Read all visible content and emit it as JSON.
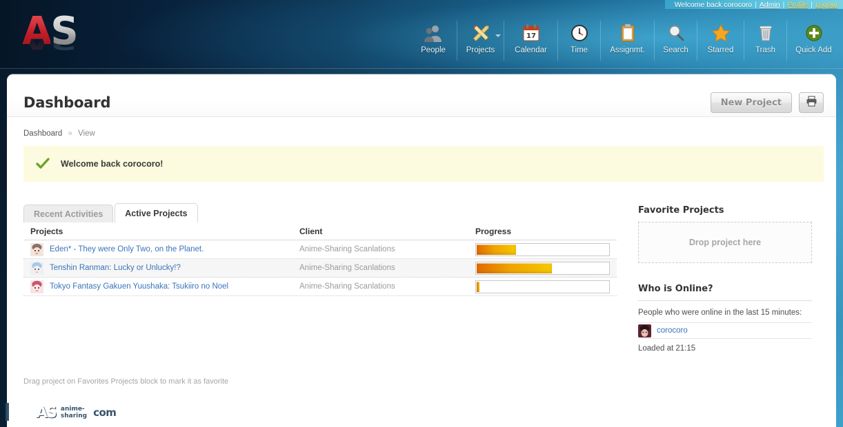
{
  "account_strip": {
    "welcome": "Welcome back corocoro",
    "sep": "|",
    "admin": "Admin",
    "profile": "Profile",
    "logout": "Logout"
  },
  "logo": {
    "text": "AS"
  },
  "topnav": {
    "items": [
      {
        "label": "People",
        "icon": "people-icon",
        "caret": false
      },
      {
        "label": "Projects",
        "icon": "projects-icon",
        "caret": true
      },
      {
        "label": "Calendar",
        "icon": "calendar-icon",
        "caret": false,
        "day": "17"
      },
      {
        "label": "Time",
        "icon": "clock-icon",
        "caret": false
      },
      {
        "label": "Assignmt.",
        "icon": "clipboard-icon",
        "caret": false
      },
      {
        "label": "Search",
        "icon": "magnifier-icon",
        "caret": false
      },
      {
        "label": "Starred",
        "icon": "star-icon",
        "caret": false
      },
      {
        "label": "Trash",
        "icon": "trash-icon",
        "caret": false
      },
      {
        "label": "Quick Add",
        "icon": "plus-circle-icon",
        "caret": false
      }
    ]
  },
  "header": {
    "title": "Dashboard",
    "new_project_label": "New Project",
    "print_icon": "printer-icon"
  },
  "breadcrumb": {
    "root": "Dashboard",
    "chevron": "»",
    "current": "View"
  },
  "notice": {
    "icon": "green-check-icon",
    "text": "Welcome back corocoro!"
  },
  "tabs": [
    {
      "label": "Recent Activities",
      "active": false
    },
    {
      "label": "Active Projects",
      "active": true
    }
  ],
  "table": {
    "columns": [
      "Projects",
      "Client",
      "Progress"
    ],
    "rows": [
      {
        "project": "Eden* - They were Only Two, on the Planet.",
        "client": "Anime-Sharing Scanlations",
        "progress": 30,
        "avatar_colors": [
          "#e8d7cf",
          "#8d6f63"
        ]
      },
      {
        "project": "Tenshin Ranman: Lucky or Unlucky!?",
        "client": "Anime-Sharing Scanlations",
        "progress": 57,
        "avatar_colors": [
          "#cfe3f2",
          "#6d93bb"
        ]
      },
      {
        "project": "Tokyo Fantasy Gakuen Yuushaka: Tsukiiro no Noel",
        "client": "Anime-Sharing Scanlations",
        "progress": 2,
        "avatar_colors": [
          "#f3cdd6",
          "#c05a77"
        ]
      }
    ]
  },
  "hint": "Drag project on Favorites Projects block to mark it as favorite",
  "sidebar": {
    "favorites_title": "Favorite Projects",
    "dropzone_text": "Drop project here",
    "online_title": "Who is Online?",
    "online_lead": "People who were online in the last 15 minutes:",
    "online_user": "corocoro",
    "loaded_at": "Loaded at 21:15"
  },
  "watermark": {
    "mark": "AS",
    "line1": "anime-",
    "line2": "sharing",
    "tld": "com"
  },
  "colors": {
    "accent_blue": "#3b73b9",
    "notice_bg": "#fcfbdf",
    "progress_orange": "#f0a400",
    "link_yellow": "#ffd24d"
  }
}
